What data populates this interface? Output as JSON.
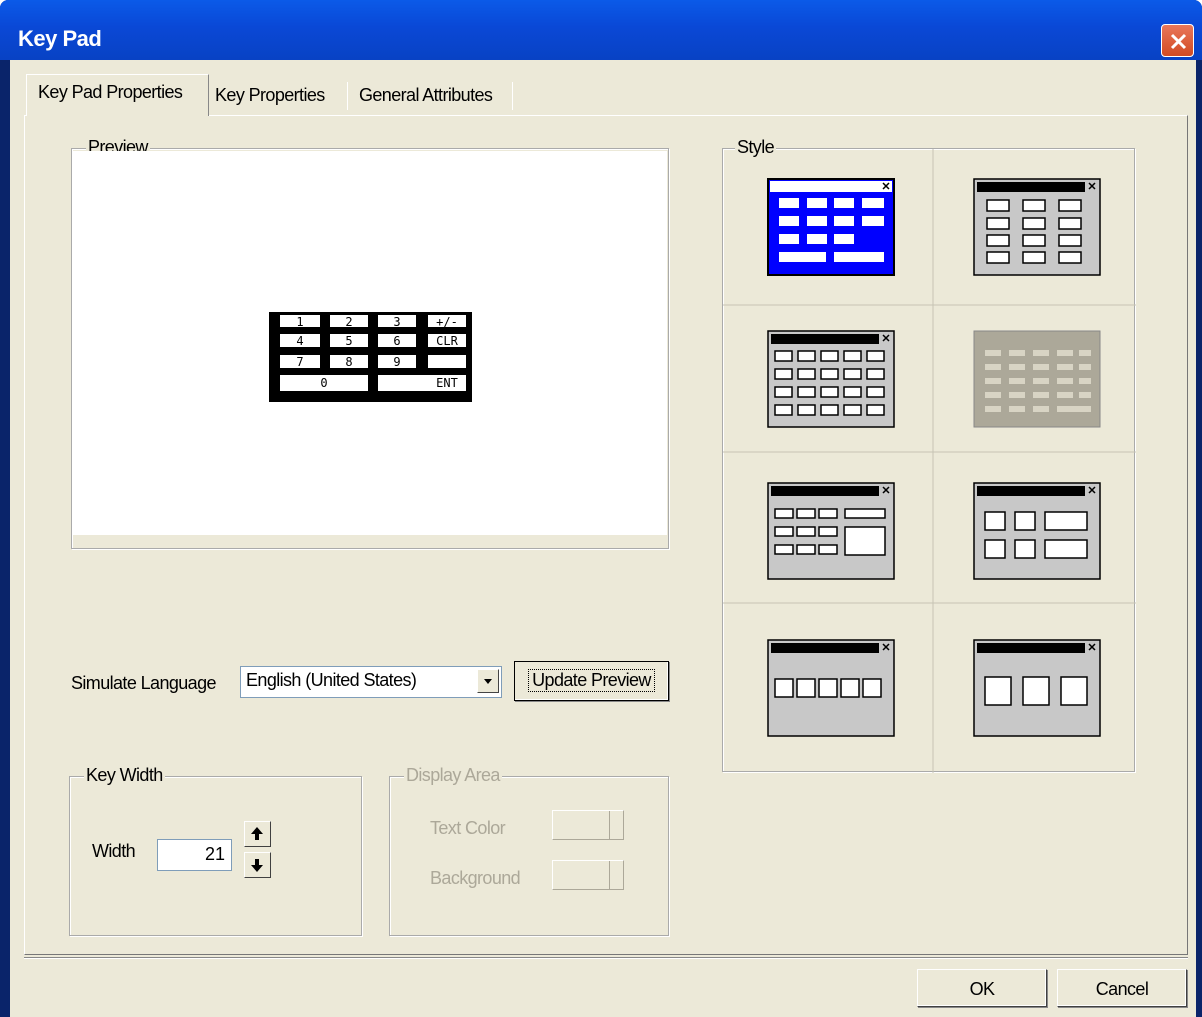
{
  "window": {
    "title": "Key Pad"
  },
  "tabs": [
    {
      "label": "Key Pad Properties"
    },
    {
      "label": "Key  Properties"
    },
    {
      "label": "General Attributes"
    }
  ],
  "preview": {
    "legend": "Preview",
    "keys": [
      "1",
      "2",
      "3",
      "+/-",
      "4",
      "5",
      "6",
      "CLR",
      "7",
      "8",
      "9",
      "0",
      "ENT"
    ]
  },
  "simulate_language": {
    "label": "Simulate Language",
    "selected": "English (United States)",
    "update_button": "Update Preview"
  },
  "key_width": {
    "legend": "Key Width",
    "width_label": "Width",
    "width_value": "21"
  },
  "display_area": {
    "legend": "Display  Area",
    "text_color_label": "Text Color",
    "background_label": "Background"
  },
  "style": {
    "legend": "Style",
    "selected_index": 0
  },
  "footer": {
    "ok": "OK",
    "cancel": "Cancel"
  }
}
